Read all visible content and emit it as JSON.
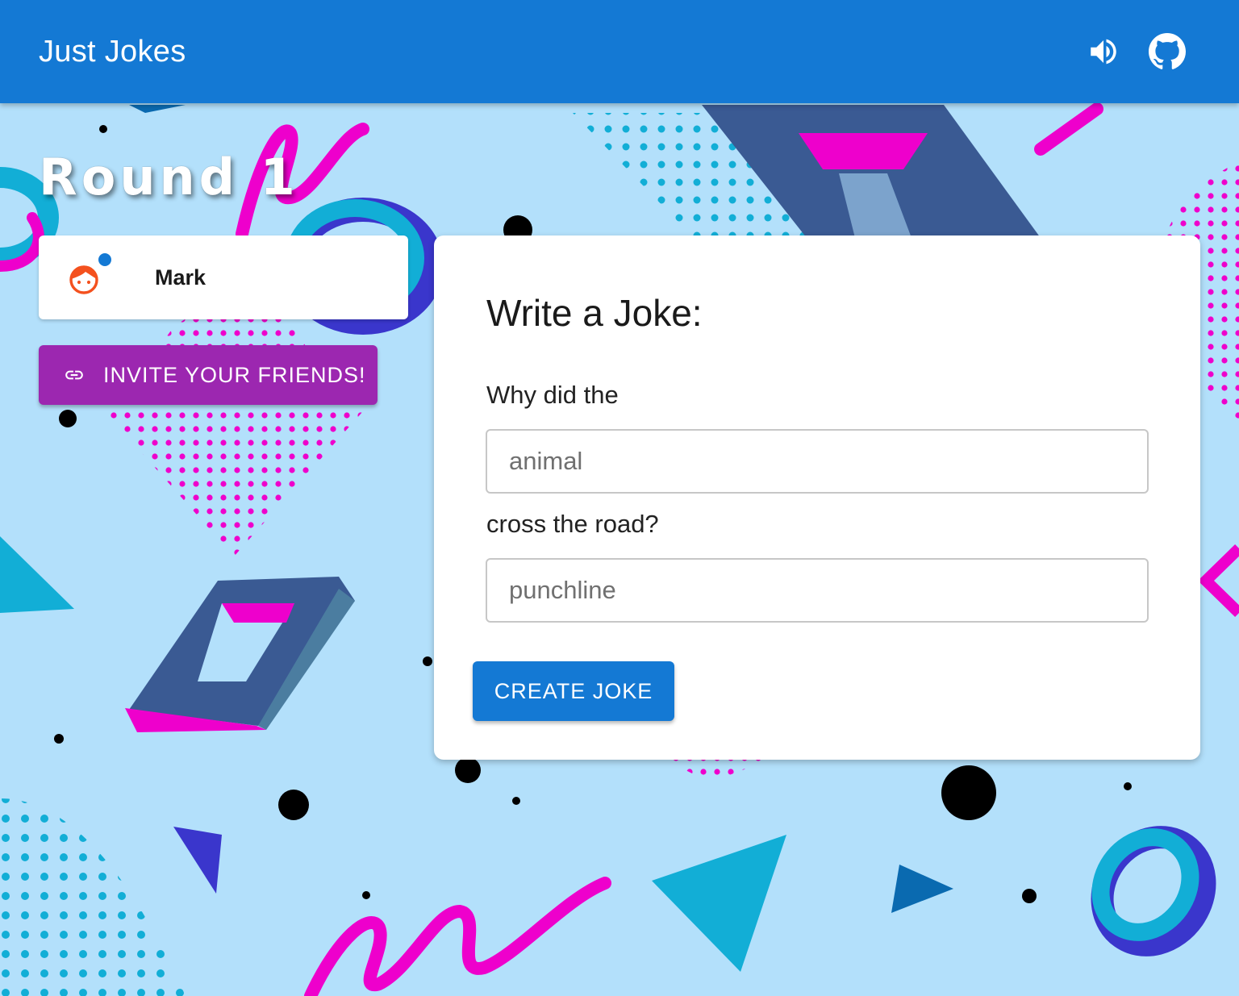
{
  "app": {
    "title": "Just Jokes"
  },
  "header": {
    "icons": [
      "volume-icon",
      "github-icon"
    ]
  },
  "round": {
    "title": "Round 1"
  },
  "player": {
    "name": "Mark",
    "avatar": "boy-face-avatar",
    "status": "online"
  },
  "invite": {
    "label": "INVITE YOUR FRIENDS!",
    "icon": "link-icon"
  },
  "joke_form": {
    "heading": "Write a Joke:",
    "prompt_start": "Why did the",
    "subject_placeholder": "animal",
    "subject_value": "",
    "prompt_middle": "cross the road?",
    "punchline_placeholder": "punchline",
    "punchline_value": "",
    "submit_label": "CREATE JOKE"
  },
  "colors": {
    "primary": "#1479d4",
    "invite": "#9c27b0",
    "background": "#b3e0fb",
    "accent_magenta": "#ee00cc",
    "accent_cyan": "#12aed6",
    "accent_indigo": "#3a36cc",
    "avatar": "#f4511e"
  }
}
